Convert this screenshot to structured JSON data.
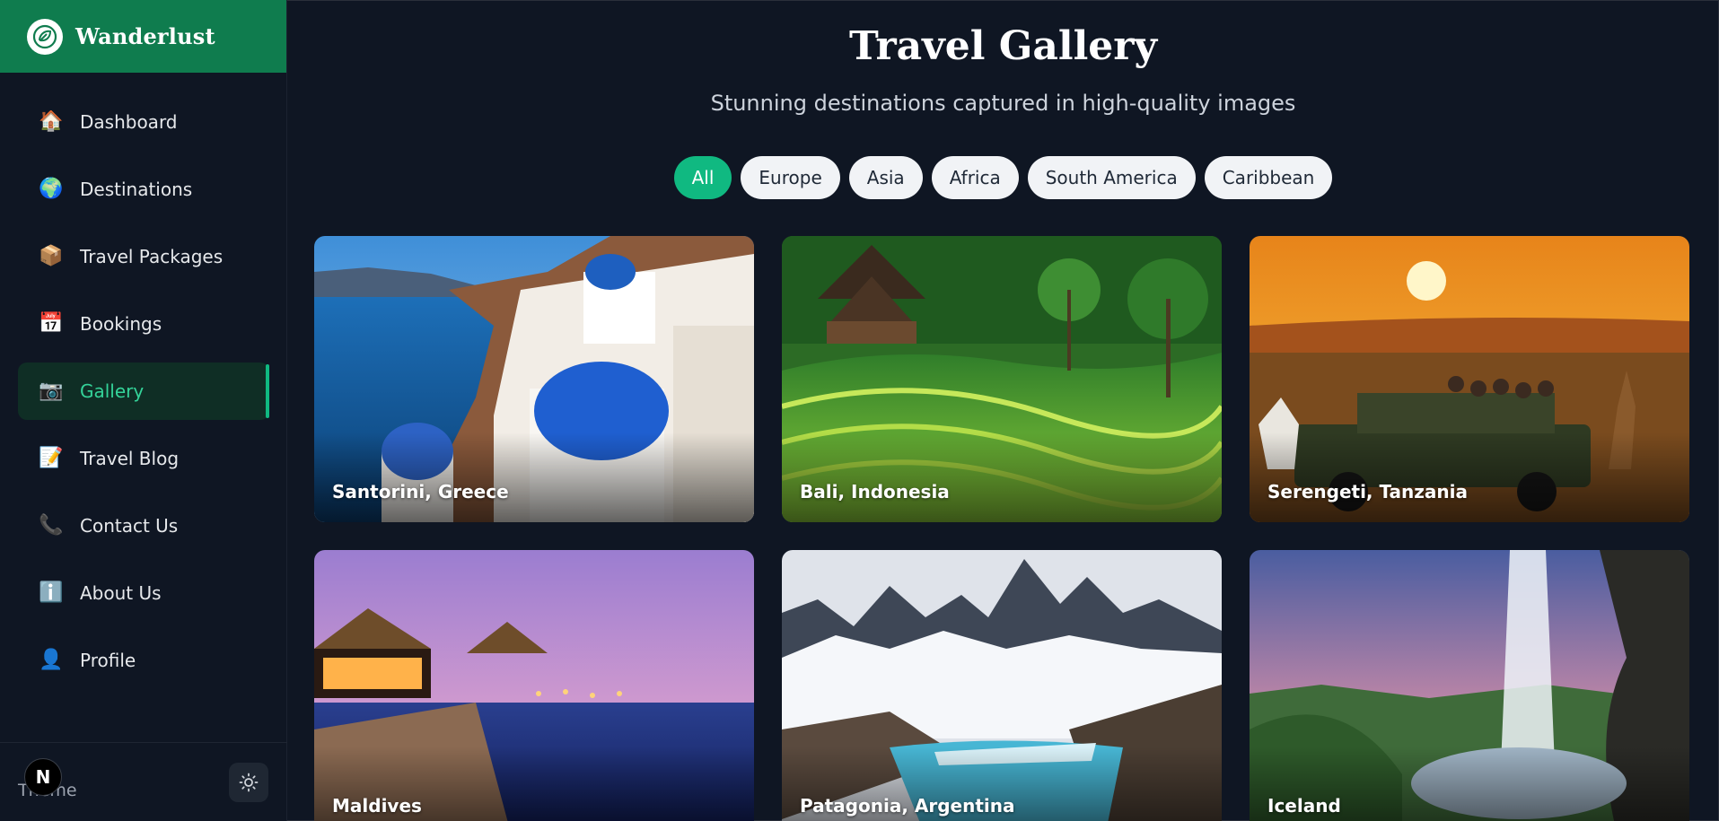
{
  "brand": {
    "name": "Wanderlust",
    "logo_icon": "leaf-badge-icon"
  },
  "sidebar": {
    "items": [
      {
        "label": "Dashboard",
        "icon": "house-icon"
      },
      {
        "label": "Destinations",
        "icon": "globe-icon"
      },
      {
        "label": "Travel Packages",
        "icon": "package-icon"
      },
      {
        "label": "Bookings",
        "icon": "calendar-icon"
      },
      {
        "label": "Gallery",
        "icon": "camera-icon",
        "active": true
      },
      {
        "label": "Travel Blog",
        "icon": "memo-icon"
      },
      {
        "label": "Contact Us",
        "icon": "phone-icon"
      },
      {
        "label": "About Us",
        "icon": "info-icon"
      },
      {
        "label": "Profile",
        "icon": "user-icon"
      }
    ],
    "footer": {
      "label": "Theme",
      "badge": "N",
      "theme_icon": "sun-icon"
    }
  },
  "page": {
    "title": "Travel Gallery",
    "subtitle": "Stunning destinations captured in high-quality images"
  },
  "filters": [
    "All",
    "Europe",
    "Asia",
    "Africa",
    "South America",
    "Caribbean"
  ],
  "active_filter": "All",
  "gallery": [
    {
      "caption": "Santorini, Greece"
    },
    {
      "caption": "Bali, Indonesia"
    },
    {
      "caption": "Serengeti, Tanzania"
    },
    {
      "caption": "Maldives"
    },
    {
      "caption": "Patagonia, Argentina"
    },
    {
      "caption": "Iceland"
    }
  ],
  "colors": {
    "accent": "#10b981",
    "brand_bar": "#0f7c4e",
    "background": "#0f1623"
  }
}
